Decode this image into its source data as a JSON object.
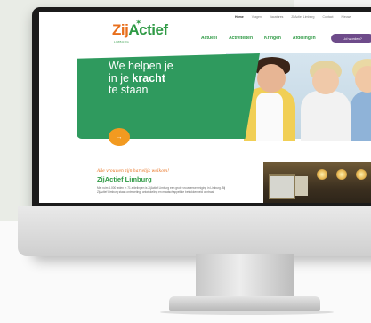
{
  "site": {
    "logo": {
      "brand_part1": "Zij",
      "brand_part2": "Actief",
      "tagline": "LIMBURG"
    },
    "top_links": [
      "Home",
      "Vragen",
      "Vacatures",
      "ZijActief Limburg",
      "Contact",
      "Nieuws"
    ],
    "nav": [
      "Actueel",
      "Activiteiten",
      "Kringen",
      "Afdelingen"
    ],
    "cta_label": "Lid worden?",
    "hero": {
      "line1": "We helpen je",
      "line2_pre": "in je",
      "line2_bold": "kracht",
      "line3": "te staan",
      "button_glyph": "→"
    },
    "welcome": {
      "script": "Alle vrouwen zijn hartelijk welkom!",
      "title": "ZijActief Limburg",
      "paragraph": "Met ruim 6.000 leden in 71 afdelingen is ZijActief Limburg een grote vrouwenvereniging in Limburg. Bij ZijActief Limburg staan ontmoeting, ontwikkeling en maatschappelijke betrokkenheid centraal."
    }
  },
  "colors": {
    "green": "#2f9a45",
    "hero_green": "#2f9a5e",
    "orange": "#e86f1c",
    "purple": "#6e4b8a"
  }
}
